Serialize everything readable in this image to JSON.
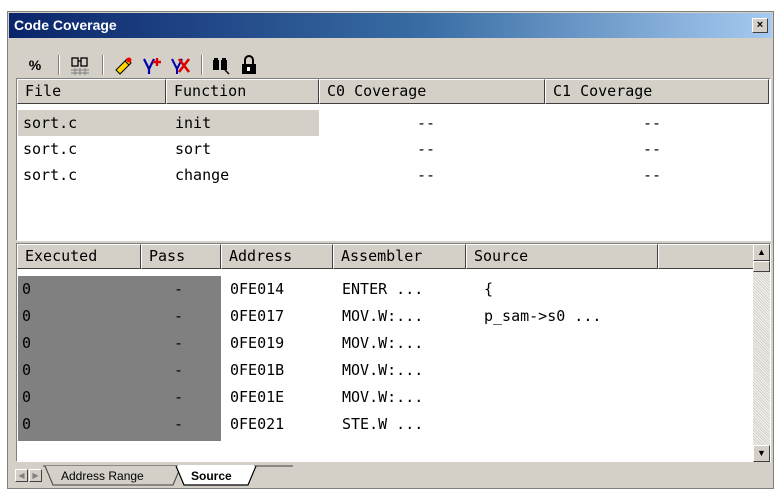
{
  "window": {
    "title": "Code Coverage",
    "close_label": "×"
  },
  "toolbar": {
    "percent_label": "%",
    "buttons": [
      "percent",
      "clear-coverage",
      "refresh",
      "add-range",
      "delete-range",
      "find",
      "lock"
    ]
  },
  "top_table": {
    "headers": [
      "File",
      "Function",
      "C0 Coverage",
      "C1 Coverage"
    ],
    "rows": [
      {
        "file": "sort.c",
        "function": "init",
        "c0": "--",
        "c1": "--"
      },
      {
        "file": "sort.c",
        "function": "sort",
        "c0": "--",
        "c1": "--"
      },
      {
        "file": "sort.c",
        "function": "change",
        "c0": "--",
        "c1": "--"
      }
    ]
  },
  "bottom_table": {
    "headers": [
      "Executed",
      "Pass",
      "Address",
      "Assembler",
      "Source"
    ],
    "rows": [
      {
        "executed": "0",
        "pass": "-",
        "address": "0FE014",
        "assembler": "ENTER ...",
        "source": "{"
      },
      {
        "executed": "0",
        "pass": "-",
        "address": "0FE017",
        "assembler": "MOV.W:...",
        "source": "p_sam->s0 ..."
      },
      {
        "executed": "0",
        "pass": "-",
        "address": "0FE019",
        "assembler": "MOV.W:...",
        "source": ""
      },
      {
        "executed": "0",
        "pass": "-",
        "address": "0FE01B",
        "assembler": "MOV.W:...",
        "source": ""
      },
      {
        "executed": "0",
        "pass": "-",
        "address": "0FE01E",
        "assembler": "MOV.W:...",
        "source": ""
      },
      {
        "executed": "0",
        "pass": "-",
        "address": "0FE021",
        "assembler": "STE.W ...",
        "source": ""
      }
    ]
  },
  "tabs": [
    {
      "label": "Address Range",
      "active": false
    },
    {
      "label": "Source",
      "active": true
    }
  ],
  "colors": {
    "title_start": "#0a246a",
    "title_end": "#a6caf0",
    "face": "#d4d0c8",
    "unexecuted": "#808080"
  }
}
